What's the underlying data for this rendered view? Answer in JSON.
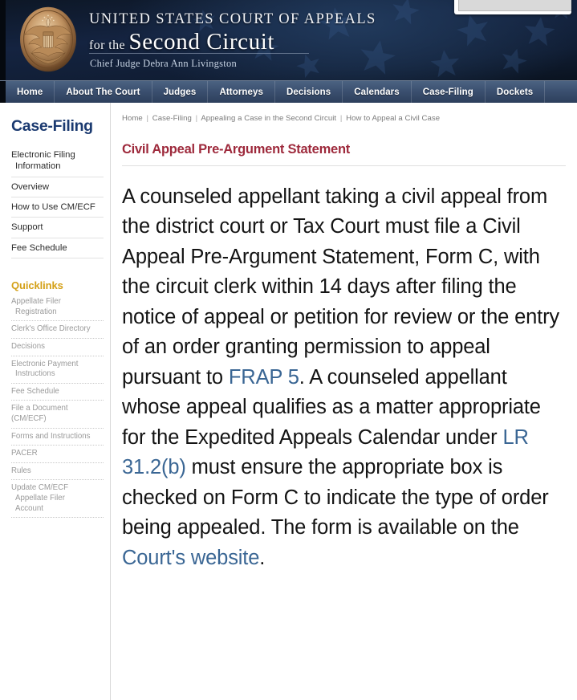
{
  "header": {
    "seal_icon": "us-court-seal-icon",
    "title_line1": "UNITED STATES COURT OF APPEALS",
    "title_prefix": "for the",
    "title_circuit": "Second Circuit",
    "chief_judge": "Chief Judge Debra Ann Livingston",
    "background": "#101d33"
  },
  "search": {
    "value": "",
    "placeholder": "",
    "icon": "search-icon",
    "button_label": ""
  },
  "nav": {
    "items": [
      {
        "label": "Home"
      },
      {
        "label": "About The Court"
      },
      {
        "label": "Judges"
      },
      {
        "label": "Attorneys"
      },
      {
        "label": "Decisions"
      },
      {
        "label": "Calendars"
      },
      {
        "label": "Case-Filing"
      },
      {
        "label": "Dockets"
      }
    ]
  },
  "sidebar": {
    "title": "Case-Filing",
    "title_color": "#1b3a70",
    "items": [
      {
        "label": "Electronic Filing",
        "label2": "Information"
      },
      {
        "label": "Overview",
        "label2": ""
      },
      {
        "label": "How to Use CM/ECF",
        "label2": ""
      },
      {
        "label": "Support",
        "label2": ""
      },
      {
        "label": "Fee Schedule",
        "label2": ""
      }
    ],
    "quicklinks_title": "Quicklinks",
    "quicklinks_color": "#d4a017",
    "quicklinks": [
      {
        "label": "Appellate Filer",
        "label2": "Registration"
      },
      {
        "label": "Clerk's Office Directory",
        "label2": ""
      },
      {
        "label": "Decisions",
        "label2": ""
      },
      {
        "label": "Electronic Payment",
        "label2": "Instructions"
      },
      {
        "label": "Fee Schedule",
        "label2": ""
      },
      {
        "label": "File a Document (CM/ECF)",
        "label2": ""
      },
      {
        "label": "Forms and Instructions",
        "label2": ""
      },
      {
        "label": "PACER",
        "label2": ""
      },
      {
        "label": "Rules",
        "label2": ""
      },
      {
        "label": "Update CM/ECF",
        "label2": "Appellate Filer",
        "label3": "Account"
      }
    ]
  },
  "breadcrumb": {
    "items": [
      {
        "label": "Home"
      },
      {
        "label": "Case-Filing"
      },
      {
        "label": "Appealing a Case in the Second Circuit"
      },
      {
        "label": "How to Appeal a Civil Case"
      }
    ],
    "separator": "|"
  },
  "main": {
    "title": "Civil Appeal Pre-Argument Statement",
    "title_color": "#9e2a3c",
    "link_color": "#3a6694",
    "paragraph": {
      "part1": "A counseled appellant taking a civil appeal from the district court or Tax Court must file a Civil Appeal Pre-Argument Statement, Form C, with the circuit clerk within 14 days after filing the notice of appeal or petition for review or the entry of an order granting permission to appeal pursuant to ",
      "link1": "FRAP 5",
      "part2": ". A counseled appellant whose appeal qualifies as a matter appropriate for the Expedited Appeals Calendar under ",
      "link2": "LR 31.2(b)",
      "part3": " must ensure the appropriate box is checked on Form C to indicate the type of order being appealed. The form is available on the ",
      "link3": "Court's website",
      "part4": "."
    }
  }
}
